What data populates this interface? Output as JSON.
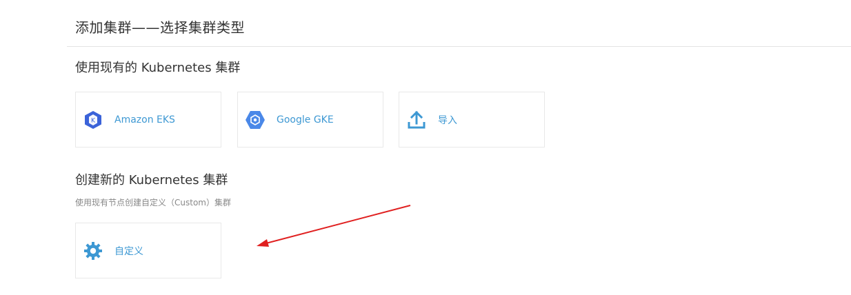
{
  "header": {
    "title": "添加集群——选择集群类型"
  },
  "existing": {
    "title": "使用现有的 Kubernetes 集群",
    "cards": [
      {
        "label": "Amazon EKS",
        "icon": "amazon-eks-icon"
      },
      {
        "label": "Google GKE",
        "icon": "google-gke-icon"
      },
      {
        "label": "导入",
        "icon": "upload-icon"
      }
    ]
  },
  "create": {
    "title": "创建新的 Kubernetes 集群",
    "description": "使用现有节点创建自定义（Custom）集群",
    "cards": [
      {
        "label": "自定义",
        "icon": "gear-icon"
      }
    ]
  },
  "colors": {
    "accent": "#3d98d3",
    "annotation_arrow": "#e02020"
  }
}
